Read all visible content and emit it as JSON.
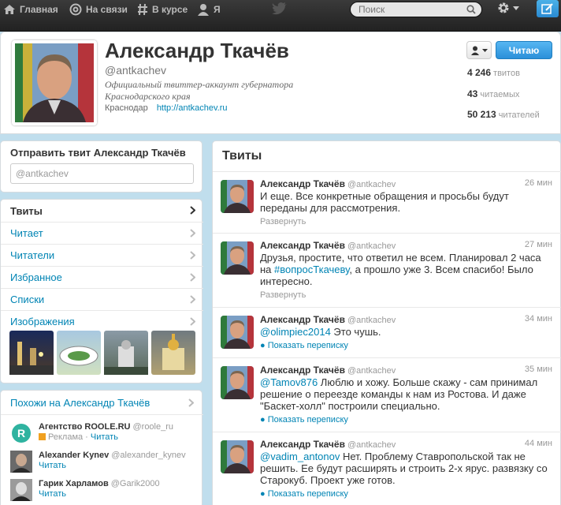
{
  "nav": {
    "home": "Главная",
    "connect": "На связи",
    "discover": "В курсе",
    "me": "Я"
  },
  "search": {
    "placeholder": "Поиск"
  },
  "profile": {
    "name": "Александр Ткачёв",
    "handle": "@antkachev",
    "bio": "Официальный твиттер-аккаунт губернатора Краснодарского края",
    "location": "Краснодар",
    "url": "http://antkachev.ru",
    "follow_label": "Читаю",
    "stats": [
      {
        "num": "4 246",
        "label": "твитов"
      },
      {
        "num": "43",
        "label": "читаемых"
      },
      {
        "num": "50 213",
        "label": "читателей"
      }
    ]
  },
  "send_tweet": {
    "title": "Отправить твит Александр Ткачёв",
    "value": "@antkachev"
  },
  "menu": [
    "Твиты",
    "Читает",
    "Читатели",
    "Избранное",
    "Списки",
    "Изображения"
  ],
  "who_to_follow": {
    "title": "Похожи на Александр Ткачёв",
    "items": [
      {
        "name": "Агентство ROOLE.RU",
        "handle": "@roole_ru",
        "ad": "Реклама",
        "follow": "Читать"
      },
      {
        "name": "Alexander Kynev",
        "handle": "@alexander_kynev",
        "follow": "Читать"
      },
      {
        "name": "Гарик Харламов",
        "handle": "@Garik2000",
        "follow": "Читать"
      }
    ]
  },
  "tweets_title": "Твиты",
  "tweets": [
    {
      "name": "Александр Ткачёв",
      "handle": "@antkachev",
      "time": "26 мин",
      "text": "И еще. Все конкретные обращения и просьбы будут переданы для рассмотрения.",
      "action": "Развернуть"
    },
    {
      "name": "Александр Ткачёв",
      "handle": "@antkachev",
      "time": "27 мин",
      "text_pre": "Друзья, простите, что ответил не всем. Планировал 2 часа на ",
      "hashtag": "#вопросТкачеву",
      "text_post": ", а прошло уже 3. Всем спасибо! Было интересно.",
      "action": "Развернуть"
    },
    {
      "name": "Александр Ткачёв",
      "handle": "@antkachev",
      "time": "34 мин",
      "mention": "@olimpiec2014",
      "text_post": " Это чушь.",
      "action": "Показать переписку"
    },
    {
      "name": "Александр Ткачёв",
      "handle": "@antkachev",
      "time": "35 мин",
      "mention": "@Tamov876",
      "text_post": " Люблю и хожу. Больше скажу - сам принимал решение о переезде команды к нам из Ростова. И даже \"Баскет-холл\" построили специально.",
      "action": "Показать переписку"
    },
    {
      "name": "Александр Ткачёв",
      "handle": "@antkachev",
      "time": "44 мин",
      "mention": "@vadim_antonov",
      "text_post": " Нет. Проблему Ставропольской так не решить. Ее будут расширять и строить 2-х ярус. развязку со Старокуб. Проект уже готов.",
      "action": "Показать переписку"
    }
  ]
}
